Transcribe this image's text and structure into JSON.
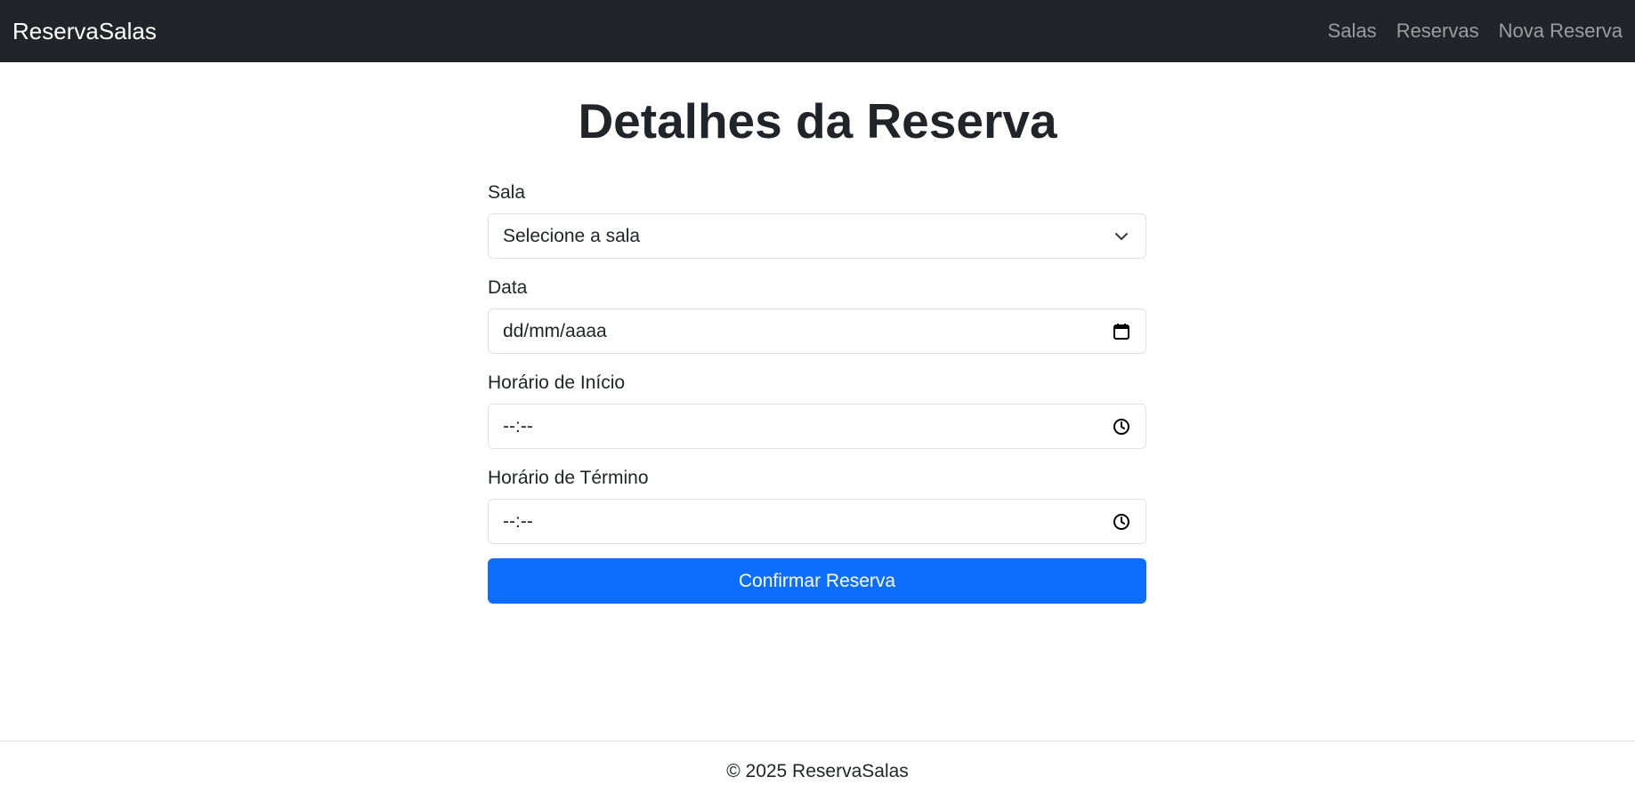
{
  "navbar": {
    "brand": "ReservaSalas",
    "links": [
      "Salas",
      "Reservas",
      "Nova Reserva"
    ]
  },
  "page_title": "Detalhes da Reserva",
  "form": {
    "sala": {
      "label": "Sala",
      "selected": "Selecione a sala",
      "icon": "chevron-down-icon"
    },
    "data": {
      "label": "Data",
      "placeholder": "dd/mm/aaaa",
      "icon": "calendar-icon"
    },
    "inicio": {
      "label": "Horário de Início",
      "placeholder": "--:--",
      "icon": "clock-icon"
    },
    "termino": {
      "label": "Horário de Término",
      "placeholder": "--:--",
      "icon": "clock-icon"
    },
    "submit_label": "Confirmar Reserva"
  },
  "footer": {
    "text": "© 2025 ReservaSalas"
  },
  "colors": {
    "navbar_bg": "#212529",
    "primary": "#0d6efd",
    "border": "#dee2e6"
  }
}
